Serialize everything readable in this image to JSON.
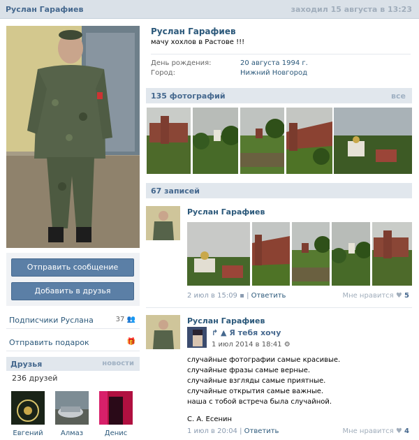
{
  "header": {
    "name": "Руслан Гарафиев",
    "last_seen": "заходил 15 августа в 13:23"
  },
  "profile": {
    "name": "Руслан Гарафиев",
    "status": "мачу хохлов в Растове !!!",
    "birthday_label": "День рождения:",
    "birthday": "20 августа 1994 г.",
    "city_label": "Город:",
    "city": "Нижний Новгород"
  },
  "actions": {
    "message": "Отправить сообщение",
    "add_friend": "Добавить в друзья"
  },
  "subscribers": {
    "label": "Подписчики Руслана",
    "count": "37"
  },
  "gift": {
    "label": "Отправить подарок"
  },
  "friends": {
    "title": "Друзья",
    "news": "новости",
    "count": "236 друзей",
    "list": [
      {
        "name": "Евгений"
      },
      {
        "name": "Алмаз"
      },
      {
        "name": "Денис"
      }
    ]
  },
  "photos": {
    "title": "135 фотографий",
    "all": "все"
  },
  "wall": {
    "title": "67 записей"
  },
  "posts": [
    {
      "author": "Руслан Гарафиев",
      "date": "2 июл в 15:09",
      "reply": "Ответить",
      "like": "Мне нравится",
      "likes": "5"
    },
    {
      "author": "Руслан Гарафиев",
      "shared_title": "Я тебя хочу",
      "shared_date": "1 июл 2014 в 18:41",
      "lines": [
        "случайные фотографии самые красивые.",
        "случайные фразы самые верные.",
        "случайные взгляды самые приятные.",
        "случайные открытия самые важные.",
        "наша с тобой встреча была случайной."
      ],
      "signature": "С. А. Есенин",
      "date": "1 июл в 20:04",
      "reply": "Ответить",
      "like": "Мне нравится",
      "likes": "4"
    }
  ],
  "colors": {
    "accent": "#45688e",
    "link": "#2b587a",
    "button": "#5b7fa6",
    "header_bg": "#dae1e8"
  }
}
